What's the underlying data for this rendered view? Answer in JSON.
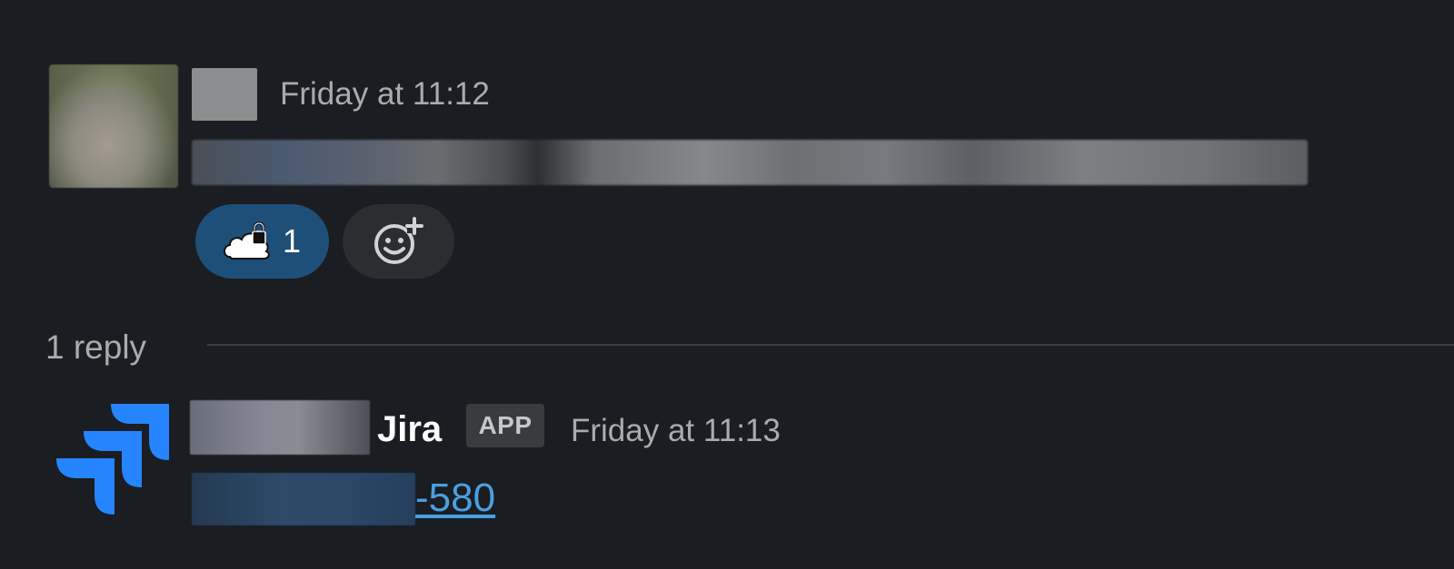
{
  "parent_message": {
    "timestamp": "Friday at 11:12",
    "reactions": [
      {
        "emoji": "cloud-lock-emoji",
        "count": "1"
      }
    ],
    "add_reaction_icon": "add-reaction-smiley-icon"
  },
  "thread": {
    "reply_count_label": "1 reply"
  },
  "reply_message": {
    "app_name": "Jira",
    "badge": "APP",
    "timestamp": "Friday at 11:13",
    "issue_key_suffix": "-580"
  },
  "colors": {
    "background": "#1a1d21",
    "reaction_active": "#1e4f78",
    "link": "#4a9fe0",
    "jira_blue": "#2684ff"
  }
}
